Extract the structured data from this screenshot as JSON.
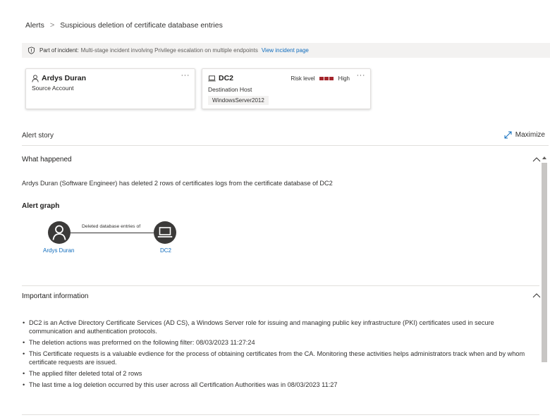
{
  "breadcrumb": {
    "root": "Alerts",
    "separator": ">",
    "current": "Suspicious deletion of certificate database entries"
  },
  "incident_banner": {
    "icon": "shield-icon",
    "label": "Part of incident:",
    "description": "Multi-stage incident involving Privilege escalation on multiple endpoints",
    "link": "View incident page"
  },
  "cards": {
    "account": {
      "icon": "person-icon",
      "name": "Ardys Duran",
      "role": "Source Account",
      "more": "···"
    },
    "host": {
      "icon": "laptop-icon",
      "name": "DC2",
      "role": "Destination Host",
      "risk_label": "Risk level",
      "risk_value": "High",
      "risk_color": "#a4262c",
      "tag": "WindowsServer2012",
      "more": "···"
    }
  },
  "alert_story": {
    "title": "Alert story",
    "maximize": "Maximize"
  },
  "what_happened": {
    "title": "What happened",
    "text": "Ardys Duran (Software Engineer) has deleted 2 rows of certificates logs from the certificate database of DC2"
  },
  "alert_graph": {
    "title": "Alert graph",
    "source": "Ardys Duran",
    "edge": "Deleted database entries of",
    "target": "DC2"
  },
  "important_information": {
    "title": "Important information",
    "items": [
      "DC2 is an Active Directory Certificate Services (AD CS), a Windows Server role for issuing and managing public key infrastructure (PKI) certificates used in secure communication and authentication protocols.",
      "The deletion actions was preformed on the following filter: 08/03/2023 11:27:24",
      "This Certificate requests is a valuable evdience for the process of obtaining certificates from the CA. Monitoring these activities helps administrators track when and by whom certificate requests are issued.",
      "The applied filter deleted total of 2 rows",
      "The last time a log deletion occurred by this user across all Certification Authorities was in 08/03/2023 11:27"
    ]
  },
  "colors": {
    "link": "#0f6cbd",
    "banner_bg": "#f3f2f1",
    "node_bg": "#3b3a39",
    "risk_high": "#a4262c"
  }
}
